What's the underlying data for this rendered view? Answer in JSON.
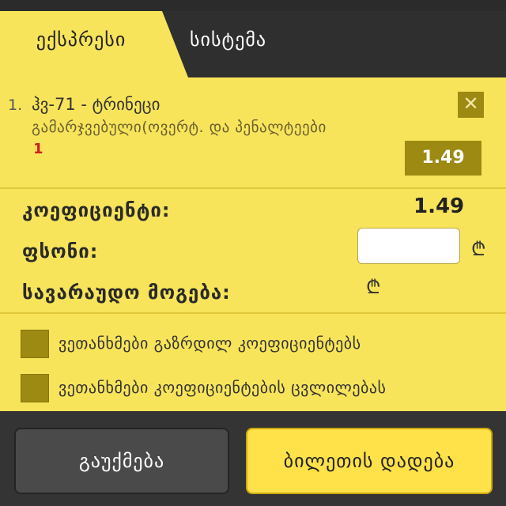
{
  "tabs": {
    "express": "ექსპრესი",
    "system": "სისტემა"
  },
  "bet": {
    "number": "1.",
    "event": "ჰვ-71 - ტრინეცი",
    "market": "გამარჯვებული(ოვერტ. და პენალტეები",
    "pick": "1",
    "odd": "1.49"
  },
  "summary": {
    "coef_label": "კოეფიციენტი:",
    "coef_value": "1.49",
    "stake_label": "ფსონი:",
    "stake_value": "",
    "win_label": "სავარაუდო მოგება:",
    "currency": "₾"
  },
  "options": {
    "accept_increased": "ვეთანხმები გაზრდილ კოეფიციენტებს",
    "accept_changes": "ვეთანხმები კოეფიციენტების ცვლილებას"
  },
  "actions": {
    "cancel": "გაუქმება",
    "place": "ბილეთის დადება"
  },
  "colors": {
    "panel": "#f8e45a",
    "dark": "#2f2f2f",
    "olive": "#9c8a12",
    "accent_red": "#cc2020"
  }
}
